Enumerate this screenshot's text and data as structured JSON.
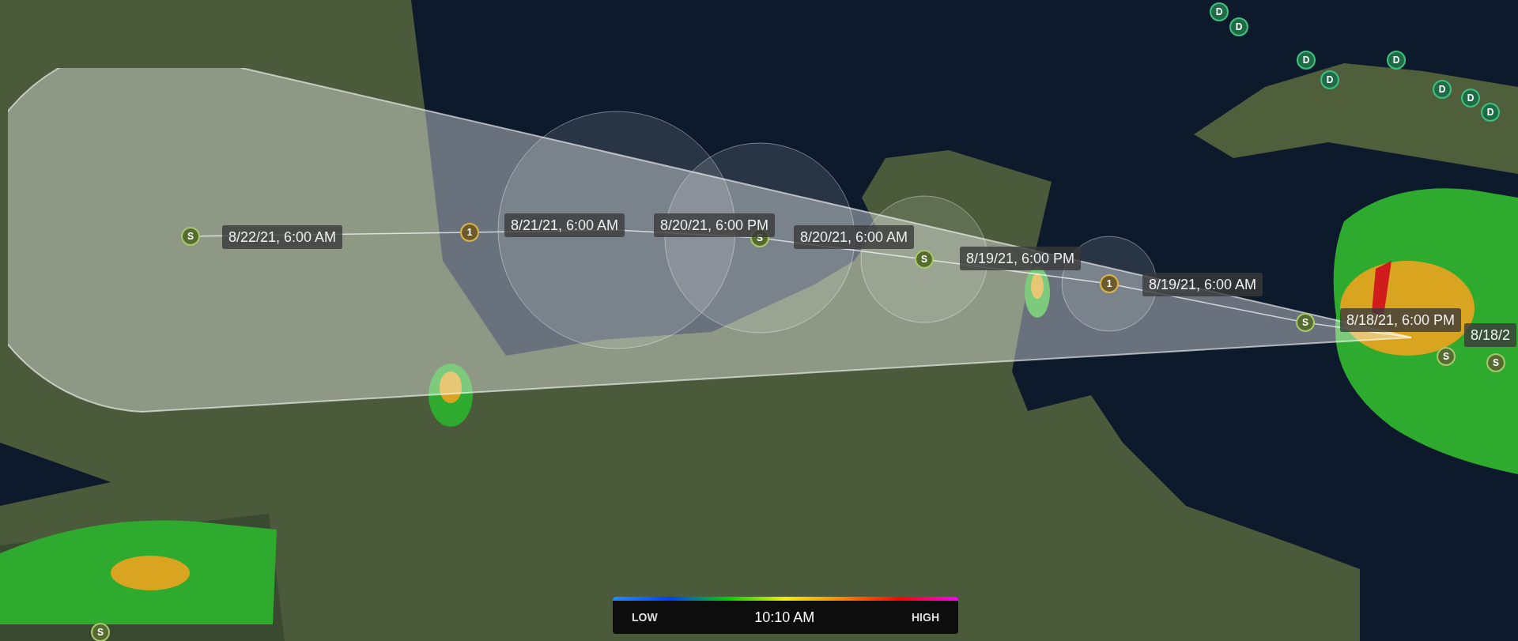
{
  "track_points": [
    {
      "kind": "storm",
      "letter": "S"
    },
    {
      "kind": "hurricane",
      "letter": "1"
    },
    {
      "kind": "storm",
      "letter": "S"
    },
    {
      "kind": "storm",
      "letter": "S"
    },
    {
      "kind": "hurricane",
      "letter": "1"
    },
    {
      "kind": "storm",
      "letter": "S"
    },
    {
      "kind": "storm",
      "letter": "S"
    },
    {
      "kind": "storm",
      "letter": "S"
    },
    {
      "kind": "depression",
      "letter": "D"
    },
    {
      "kind": "depression",
      "letter": "D"
    },
    {
      "kind": "depression",
      "letter": "D"
    },
    {
      "kind": "depression",
      "letter": "D"
    },
    {
      "kind": "depression",
      "letter": "D"
    },
    {
      "kind": "depression",
      "letter": "D"
    },
    {
      "kind": "depression",
      "letter": "D"
    },
    {
      "kind": "depression",
      "letter": "D"
    },
    {
      "kind": "storm",
      "letter": "S"
    }
  ],
  "time_labels": [
    "8/22/21, 6:00 AM",
    "8/21/21, 6:00 AM",
    "8/20/21, 6:00 PM",
    "8/20/21, 6:00 AM",
    "8/19/21, 6:00 PM",
    "8/19/21, 6:00 AM",
    "8/18/21, 6:00 PM",
    "8/18/2"
  ],
  "legend": {
    "low": "LOW",
    "time": "10:10 AM",
    "high": "HIGH"
  }
}
